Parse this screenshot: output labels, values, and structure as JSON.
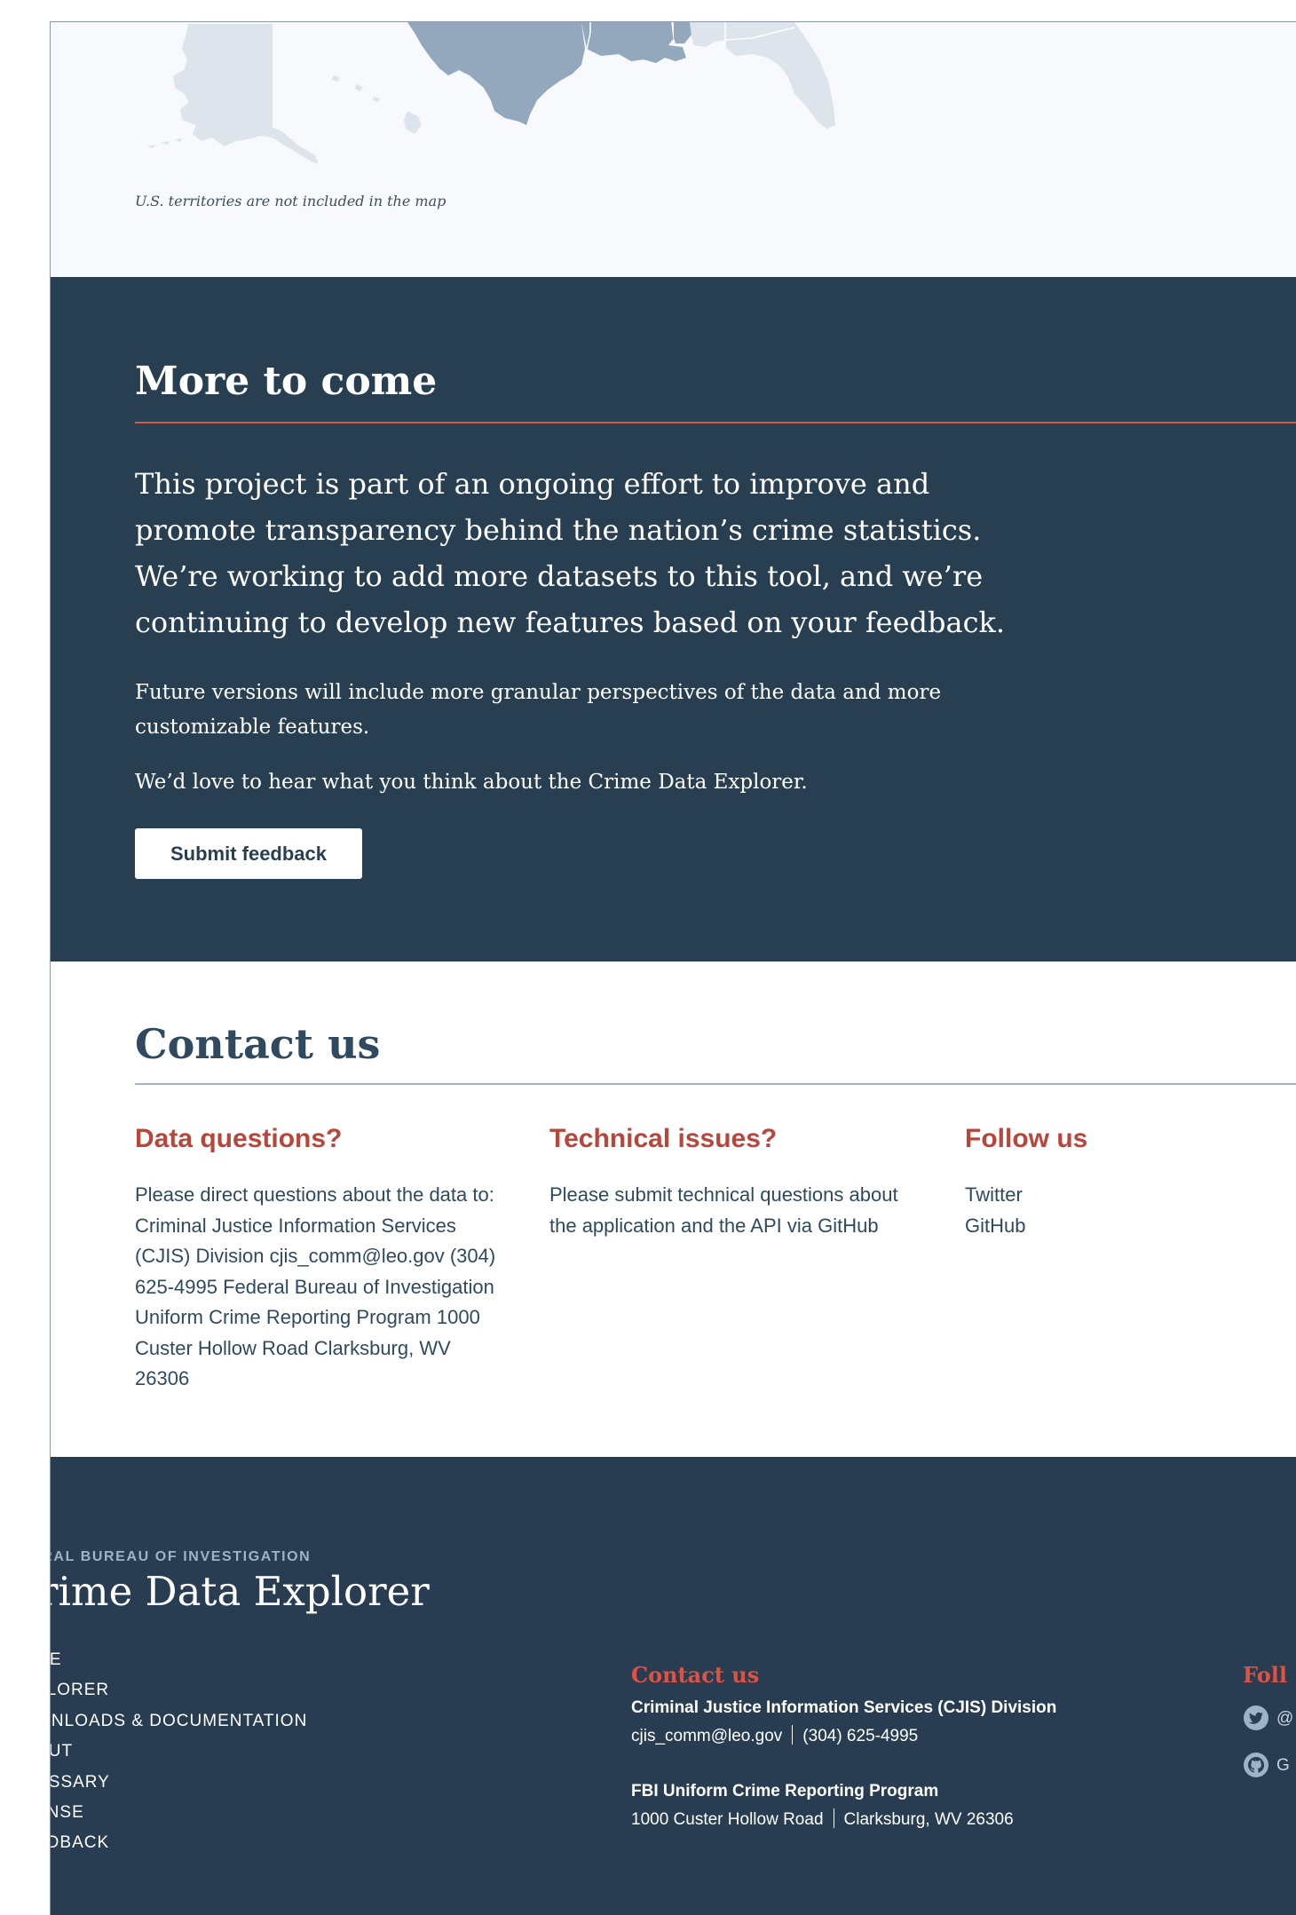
{
  "map": {
    "note": "U.S. territories are not included in the map"
  },
  "more_to_come": {
    "title": "More to come",
    "lead": "This project is part of an ongoing effort to improve and promote transparency behind the nation’s crime statistics. We’re working to add more datasets to this tool, and we’re continuing to develop new features based on your feedback.",
    "paragraph_1": "Future versions will include more granular perspectives of the data and more customizable features.",
    "paragraph_2": "We’d love to hear what you think about the Crime Data Explorer.",
    "button_label": "Submit feedback"
  },
  "contact": {
    "title": "Contact us",
    "data_questions": {
      "heading": "Data questions?",
      "text": "Please direct questions about the data to: Criminal Justice Information Services (CJIS) Division cjis_comm@leo.gov (304) 625-4995 Federal Bureau of Investigation Uniform Crime Reporting Program 1000 Custer Hollow Road Clarksburg, WV 26306"
    },
    "technical_issues": {
      "heading": "Technical issues?",
      "text": "Please submit technical questions about the application and the API via GitHub"
    },
    "follow_us": {
      "heading": "Follow us",
      "links": [
        "Twitter",
        "GitHub"
      ]
    }
  },
  "footer": {
    "agency": "ERAL BUREAU OF INVESTIGATION",
    "brand": "rime Data Explorer",
    "nav": [
      "ME",
      "PLORER",
      "WNLOADS & DOCUMENTATION",
      "OUT",
      "OSSARY",
      "ENSE",
      "EDBACK"
    ],
    "contact_heading": "Contact us",
    "cjis_name": "Criminal Justice Information Services (CJIS) Division",
    "cjis_email": "cjis_comm@leo.gov",
    "cjis_phone": "(304) 625-4995",
    "ucr_name": "FBI Uniform Crime Reporting Program",
    "ucr_street": "1000 Custer Hollow Road",
    "ucr_city": "Clarksburg, WV 26306",
    "follow_heading": "Foll",
    "twitter_label": "@",
    "github_label": "G"
  },
  "colors": {
    "navy": "#283f52",
    "accent_red": "#b8463a",
    "map_highlight": "#94a8bd",
    "map_muted": "#dde4ec"
  }
}
